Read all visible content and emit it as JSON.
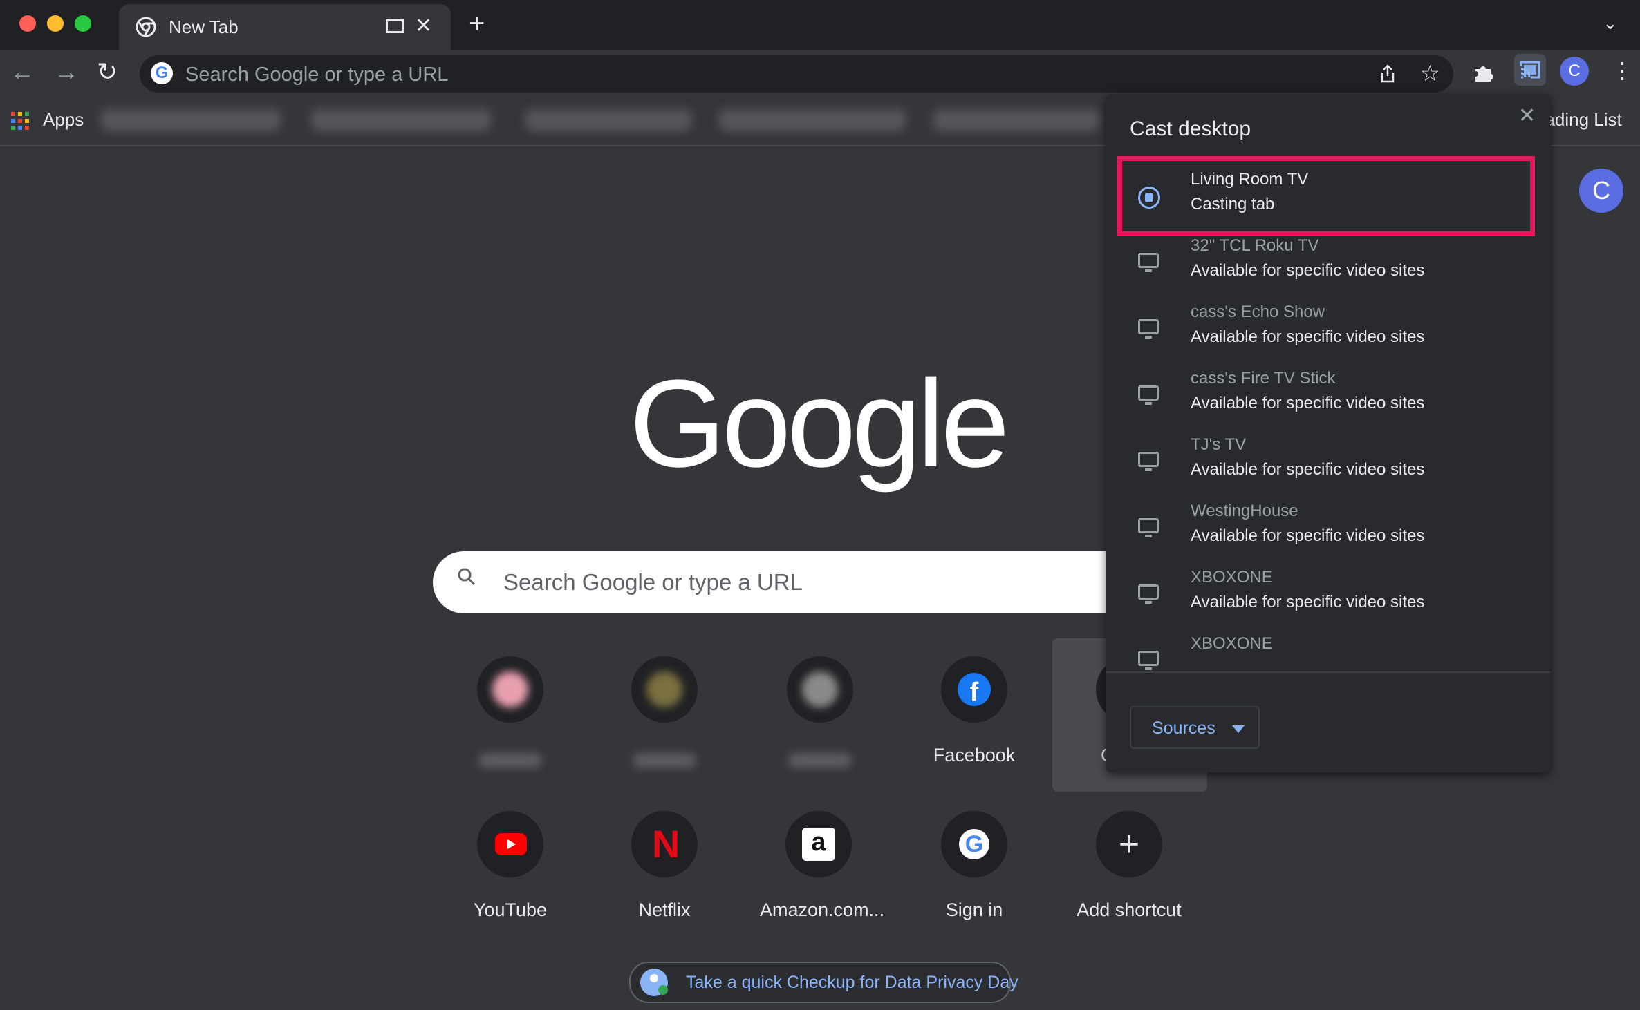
{
  "browser": {
    "tab_title": "New Tab",
    "tab_close": "✕",
    "new_tab": "+",
    "tab_menu": "⌄",
    "omnibox_placeholder": "Search Google or type a URL",
    "profile_initial": "C"
  },
  "bookmarks": {
    "apps_label": "Apps",
    "reading_list_label": "eading List"
  },
  "ntp": {
    "logo": "Google",
    "search_placeholder": "Search Google or type a URL",
    "avatar_initial": "C",
    "shortcuts_row1": [
      {
        "label": "",
        "blurred": true
      },
      {
        "label": "",
        "blurred": true
      },
      {
        "label": "",
        "blurred": true
      },
      {
        "label": "Facebook",
        "icon": "facebook-icon"
      },
      {
        "label": "C",
        "icon": "hidden"
      }
    ],
    "shortcuts_row2": [
      {
        "label": "YouTube",
        "icon": "youtube-icon"
      },
      {
        "label": "Netflix",
        "icon": "netflix-icon"
      },
      {
        "label": "Amazon.com...",
        "icon": "amazon-icon"
      },
      {
        "label": "Sign in",
        "icon": "google-icon"
      },
      {
        "label": "Add shortcut",
        "icon": "plus-icon"
      }
    ],
    "privacy_promo": "Take a quick Checkup for Data Privacy Day"
  },
  "cast_dialog": {
    "title": "Cast desktop",
    "close": "✕",
    "sinks": [
      {
        "name": "Living Room TV",
        "status": "Casting tab",
        "active": true
      },
      {
        "name": "32\" TCL Roku TV",
        "status": "Available for specific video sites"
      },
      {
        "name": "cass's Echo Show",
        "status": "Available for specific video sites"
      },
      {
        "name": "cass's Fire TV Stick",
        "status": "Available for specific video sites"
      },
      {
        "name": "TJ's TV",
        "status": "Available for specific video sites"
      },
      {
        "name": "WestingHouse",
        "status": "Available for specific video sites"
      },
      {
        "name": "XBOXONE",
        "status": "Available for specific video sites"
      },
      {
        "name": "XBOXONE",
        "status": ""
      }
    ],
    "sources_label": "Sources"
  },
  "colors": {
    "highlight": "#e8175d",
    "accent": "#8ab4f8",
    "avatar": "#5b6ee1"
  }
}
